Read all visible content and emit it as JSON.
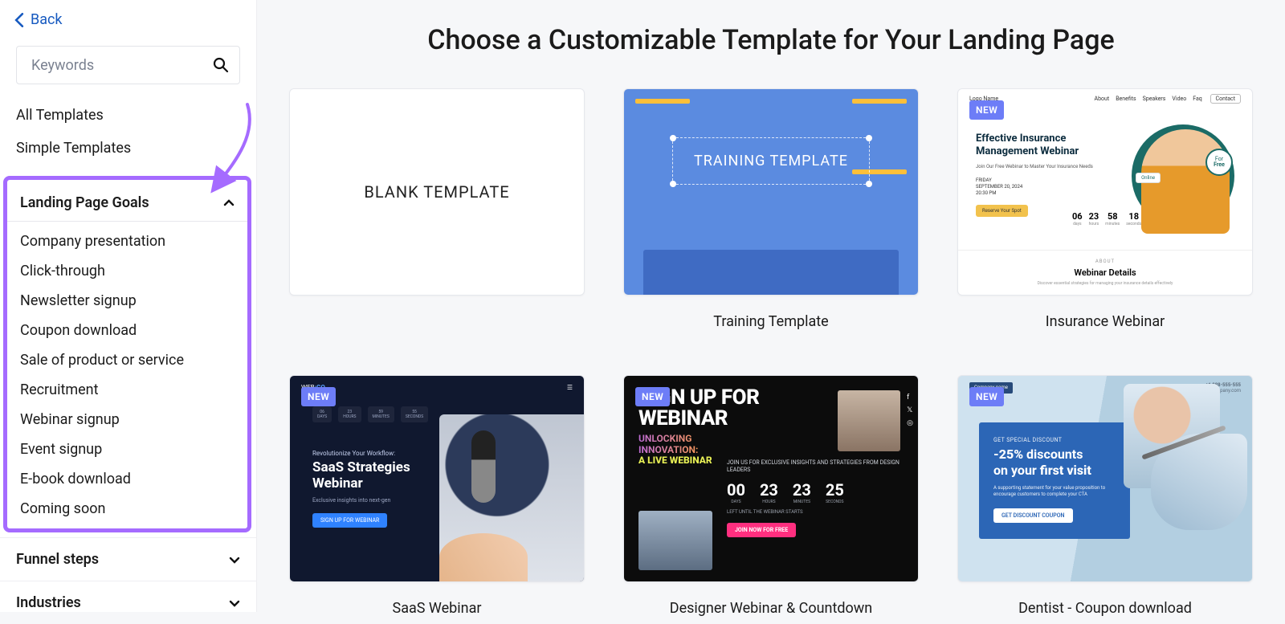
{
  "back_label": "Back",
  "search": {
    "placeholder": "Keywords"
  },
  "quick_links": [
    "All Templates",
    "Simple Templates"
  ],
  "sections": {
    "goals": {
      "title": "Landing Page Goals",
      "items": [
        "Company presentation",
        "Click-through",
        "Newsletter signup",
        "Coupon download",
        "Sale of product or service",
        "Recruitment",
        "Webinar signup",
        "Event signup",
        "E-book download",
        "Coming soon"
      ]
    },
    "funnel": {
      "title": "Funnel steps"
    },
    "industries": {
      "title": "Industries"
    }
  },
  "page_title": "Choose a Customizable Template for Your Landing Page",
  "new_label": "NEW",
  "templates": [
    {
      "id": "blank",
      "display": "BLANK TEMPLATE",
      "title": "",
      "new": false
    },
    {
      "id": "training",
      "display": "TRAINING TEMPLATE",
      "title": "Training Template",
      "new": false
    },
    {
      "id": "insurance",
      "title": "Insurance Webinar",
      "new": true,
      "nav": {
        "logo": "Logo Name",
        "links": [
          "About",
          "Benefits",
          "Speakers",
          "Video",
          "Faq"
        ],
        "cta": "Contact"
      },
      "heading": "Effective Insurance Management Webinar",
      "sub": "Join Our Free Webinar to Master Your Insurance Needs",
      "date": [
        "FRIDAY",
        "SEPTEMBER 20, 2024",
        "20:30 PM"
      ],
      "cta": "Reserve Your Spot",
      "badge_online": "Online",
      "badge_free_top": "For",
      "badge_free_bottom": "Free",
      "countdown": [
        {
          "n": "06",
          "u": "days"
        },
        {
          "n": "23",
          "u": "hours"
        },
        {
          "n": "58",
          "u": "minutes"
        },
        {
          "n": "18",
          "u": "seconds"
        }
      ],
      "details_kicker": "ABOUT",
      "details_title": "Webinar Details",
      "details_sub": "Discover essential strategies for managing your insurance details effectively"
    },
    {
      "id": "saas",
      "title": "SaaS Webinar",
      "new": true,
      "brand_a": "WEB",
      "brand_b": ":GO",
      "countdown": [
        {
          "n": "06",
          "u": "DAYS"
        },
        {
          "n": "23",
          "u": "HOURS"
        },
        {
          "n": "59",
          "u": "MINUTES"
        },
        {
          "n": "55",
          "u": "SECONDS"
        }
      ],
      "kicker": "Revolutionize Your Workflow:",
      "heading": "SaaS Strategies Webinar",
      "sub": "Exclusive insights into next-gen",
      "cta": "SIGN UP FOR WEBINAR"
    },
    {
      "id": "designer",
      "title": "Designer Webinar & Countdown",
      "new": true,
      "heading_a": "SIGN UP FOR",
      "heading_b": "WEBINAR",
      "grad_a": "UNLOCKING",
      "grad_b": "INNOVATION:",
      "live": "A LIVE WEBINAR",
      "lead": "JOIN US FOR EXCLUSIVE INSIGHTS AND STRATEGIES FROM DESIGN LEADERS",
      "countdown": [
        {
          "n": "00",
          "u": "DAYS"
        },
        {
          "n": "23",
          "u": "HOURS"
        },
        {
          "n": "23",
          "u": "MINUTES"
        },
        {
          "n": "25",
          "u": "SECONDS"
        }
      ],
      "left": "LEFT UNTIL THE WEBINAR STARTS",
      "cta": "JOIN NOW FOR FREE"
    },
    {
      "id": "dentist",
      "title": "Dentist - Coupon download",
      "new": true,
      "brand": "Company name",
      "phone": "+1 888-555-555",
      "phone_sub": "info@yourcompany.com",
      "kicker": "GET SPECIAL DISCOUNT",
      "heading_a": "-25% ",
      "heading_b": "discounts",
      "heading_c": "on your ",
      "heading_d": "first visit",
      "sub": "A supporting statement for your value proposition to encourage customers to complete your CTA",
      "cta": "GET DISCOUNT COUPON"
    }
  ]
}
